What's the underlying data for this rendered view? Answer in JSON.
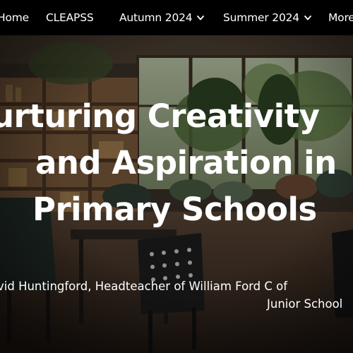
{
  "nav": {
    "items": [
      {
        "label": "Home",
        "has_dropdown": false
      },
      {
        "label": "CLEAPSS",
        "has_dropdown": false
      },
      {
        "label": "Autumn 2024",
        "has_dropdown": true
      },
      {
        "label": "Summer 2024",
        "has_dropdown": true
      },
      {
        "label": "More",
        "has_dropdown": false
      }
    ],
    "dropdown_icon": "chevron-down-icon",
    "background": "#000000",
    "text_color": "#ffffff"
  },
  "hero": {
    "title_lines": [
      "urturing Creativity",
      "and Aspiration in",
      "Primary Schools"
    ],
    "byline_lines": [
      "vid Huntingford, Headteacher of William Ford C of",
      "Junior School"
    ],
    "text_color": "#ffffff",
    "background_image": "classroom-interior-photo"
  }
}
